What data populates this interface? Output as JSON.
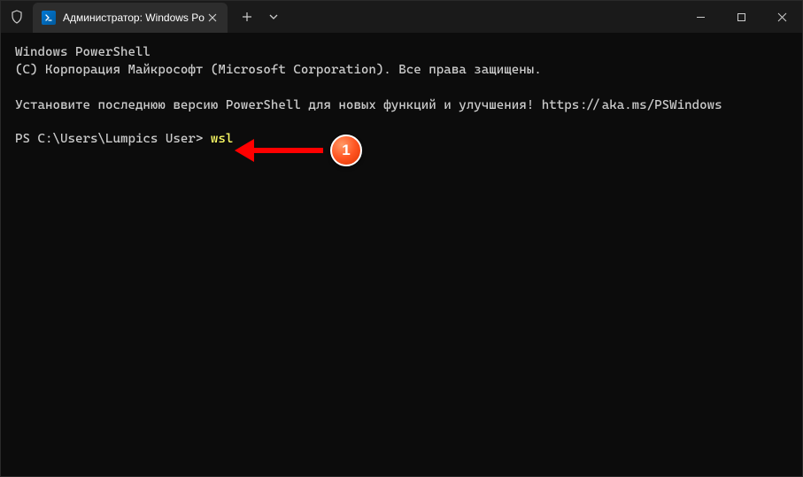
{
  "window": {
    "tab_title": "Администратор: Windows Po"
  },
  "terminal": {
    "line1": "Windows PowerShell",
    "line2": "(C) Корпорация Майкрософт (Microsoft Corporation). Все права защищены.",
    "line3": "Установите последнюю версию PowerShell для новых функций и улучшения! https://aka.ms/PSWindows",
    "prompt": "PS C:\\Users\\Lumpics User> ",
    "command": "wsl"
  },
  "annotation": {
    "badge_number": "1"
  }
}
